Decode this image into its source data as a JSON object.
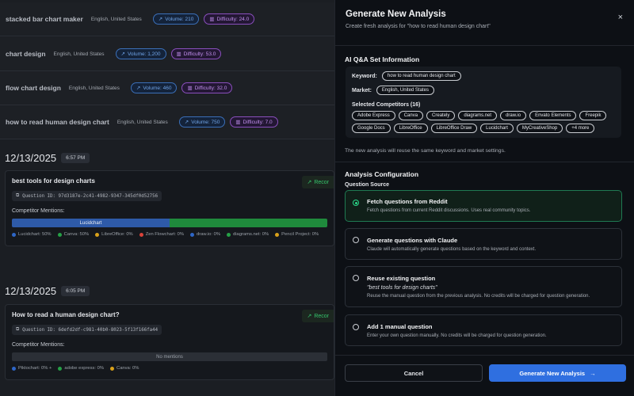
{
  "keywords": [
    {
      "keyword": "stacked bar chart maker",
      "market": "English, United States",
      "volume": "Volume: 210",
      "difficulty": "Difficulty: 24.0"
    },
    {
      "keyword": "chart design",
      "market": "English, United States",
      "volume": "Volume: 1,200",
      "difficulty": "Difficulty: 53.0"
    },
    {
      "keyword": "flow chart design",
      "market": "English, United States",
      "volume": "Volume: 460",
      "difficulty": "Difficulty: 32.0"
    },
    {
      "keyword": "how to read human design chart",
      "market": "English, United States",
      "volume": "Volume: 750",
      "difficulty": "Difficulty: 7.0"
    }
  ],
  "analyses": [
    {
      "date": "12/13/2025",
      "time": "6:57 PM",
      "question": "best tools for design charts",
      "question_id": "Question ID: 97d3187e-2c41-4982-9347-345df0d52756",
      "mentions_label": "Competitor Mentions:",
      "reco": "Recor",
      "bar_label": "Lucidchart",
      "legend": [
        "Lucidchart: 50%",
        "Canva: 50%",
        "LibreOffice: 0%",
        "Zen Flowchart: 0%",
        "draw.io: 0%",
        "diagrams.net: 0%",
        "Pencil Project: 0%"
      ],
      "legend_colors": [
        "#2e66c7",
        "#26a046",
        "#d9a11a",
        "#d9423a",
        "#2e66c7",
        "#26a046",
        "#d9a11a"
      ]
    },
    {
      "date": "12/13/2025",
      "time": "6:05 PM",
      "question": "How to read a human design chart?",
      "question_id": "Question ID: 6defd2df-c981-40b0-8023-5f13f166fa44",
      "mentions_label": "Competitor Mentions:",
      "reco": "Recor",
      "bar_label": "No mentions",
      "legend": [
        "Piktochart: 0% +",
        "adobe express: 0%",
        "Canva: 0%"
      ],
      "legend_colors": [
        "#2e66c7",
        "#26a046",
        "#d9a11a"
      ]
    }
  ],
  "panel": {
    "title": "Generate New Analysis",
    "subtitle": "Create fresh analysis for \"how to read human design chart\"",
    "close": "×",
    "info_title": "AI Q&A Set Information",
    "keyword_label": "Keyword:",
    "keyword_value": "how to read human design chart",
    "market_label": "Market:",
    "market_value": "English, United States",
    "competitors_label": "Selected Competitors (16)",
    "competitors": [
      "Adobe Express",
      "Canva",
      "Creately",
      "diagrams.net",
      "draw.io",
      "Envato Elements",
      "Freepik",
      "Google Docs",
      "LibreOffice",
      "LibreOffice Draw",
      "Lucidchart",
      "MyCreativeShop",
      "+4 more"
    ],
    "reuse_note": "The new analysis will reuse the same keyword and market settings.",
    "config_title": "Analysis Configuration",
    "source_label": "Question Source",
    "options": [
      {
        "title": "Fetch questions from Reddit",
        "desc": "Fetch questions from current Reddit discussions. Uses real community topics.",
        "selected": true
      },
      {
        "title": "Generate questions with Claude",
        "desc": "Claude will automatically generate questions based on the keyword and context.",
        "selected": false
      },
      {
        "title": "Reuse existing question",
        "quote": "\"best tools for design charts\"",
        "desc": "Reuse the manual question from the previous analysis. No credits will be charged for question generation.",
        "selected": false
      },
      {
        "title": "Add 1 manual question",
        "desc": "Enter your own question manually. No credits will be charged for question generation.",
        "selected": false
      }
    ],
    "cancel_label": "Cancel",
    "submit_label": "Generate New Analysis"
  },
  "colors": {
    "accent": "#2f6fe0",
    "selected": "#2bd98a",
    "volume": "#6fa3e6",
    "difficulty": "#c28fee"
  }
}
